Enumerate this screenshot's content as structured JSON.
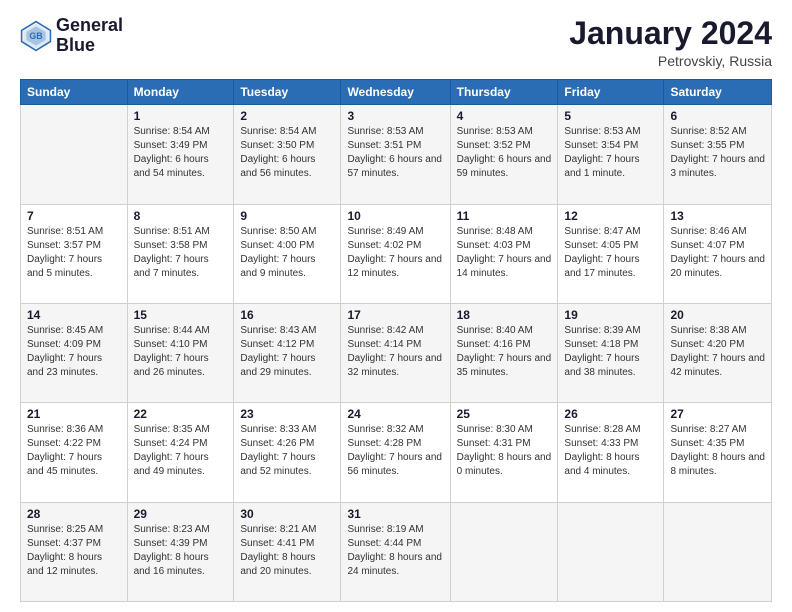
{
  "logo": {
    "line1": "General",
    "line2": "Blue"
  },
  "title": "January 2024",
  "subtitle": "Petrovskiy, Russia",
  "header_days": [
    "Sunday",
    "Monday",
    "Tuesday",
    "Wednesday",
    "Thursday",
    "Friday",
    "Saturday"
  ],
  "weeks": [
    [
      {
        "day": "",
        "sunrise": "",
        "sunset": "",
        "daylight": ""
      },
      {
        "day": "1",
        "sunrise": "Sunrise: 8:54 AM",
        "sunset": "Sunset: 3:49 PM",
        "daylight": "Daylight: 6 hours and 54 minutes."
      },
      {
        "day": "2",
        "sunrise": "Sunrise: 8:54 AM",
        "sunset": "Sunset: 3:50 PM",
        "daylight": "Daylight: 6 hours and 56 minutes."
      },
      {
        "day": "3",
        "sunrise": "Sunrise: 8:53 AM",
        "sunset": "Sunset: 3:51 PM",
        "daylight": "Daylight: 6 hours and 57 minutes."
      },
      {
        "day": "4",
        "sunrise": "Sunrise: 8:53 AM",
        "sunset": "Sunset: 3:52 PM",
        "daylight": "Daylight: 6 hours and 59 minutes."
      },
      {
        "day": "5",
        "sunrise": "Sunrise: 8:53 AM",
        "sunset": "Sunset: 3:54 PM",
        "daylight": "Daylight: 7 hours and 1 minute."
      },
      {
        "day": "6",
        "sunrise": "Sunrise: 8:52 AM",
        "sunset": "Sunset: 3:55 PM",
        "daylight": "Daylight: 7 hours and 3 minutes."
      }
    ],
    [
      {
        "day": "7",
        "sunrise": "Sunrise: 8:51 AM",
        "sunset": "Sunset: 3:57 PM",
        "daylight": "Daylight: 7 hours and 5 minutes."
      },
      {
        "day": "8",
        "sunrise": "Sunrise: 8:51 AM",
        "sunset": "Sunset: 3:58 PM",
        "daylight": "Daylight: 7 hours and 7 minutes."
      },
      {
        "day": "9",
        "sunrise": "Sunrise: 8:50 AM",
        "sunset": "Sunset: 4:00 PM",
        "daylight": "Daylight: 7 hours and 9 minutes."
      },
      {
        "day": "10",
        "sunrise": "Sunrise: 8:49 AM",
        "sunset": "Sunset: 4:02 PM",
        "daylight": "Daylight: 7 hours and 12 minutes."
      },
      {
        "day": "11",
        "sunrise": "Sunrise: 8:48 AM",
        "sunset": "Sunset: 4:03 PM",
        "daylight": "Daylight: 7 hours and 14 minutes."
      },
      {
        "day": "12",
        "sunrise": "Sunrise: 8:47 AM",
        "sunset": "Sunset: 4:05 PM",
        "daylight": "Daylight: 7 hours and 17 minutes."
      },
      {
        "day": "13",
        "sunrise": "Sunrise: 8:46 AM",
        "sunset": "Sunset: 4:07 PM",
        "daylight": "Daylight: 7 hours and 20 minutes."
      }
    ],
    [
      {
        "day": "14",
        "sunrise": "Sunrise: 8:45 AM",
        "sunset": "Sunset: 4:09 PM",
        "daylight": "Daylight: 7 hours and 23 minutes."
      },
      {
        "day": "15",
        "sunrise": "Sunrise: 8:44 AM",
        "sunset": "Sunset: 4:10 PM",
        "daylight": "Daylight: 7 hours and 26 minutes."
      },
      {
        "day": "16",
        "sunrise": "Sunrise: 8:43 AM",
        "sunset": "Sunset: 4:12 PM",
        "daylight": "Daylight: 7 hours and 29 minutes."
      },
      {
        "day": "17",
        "sunrise": "Sunrise: 8:42 AM",
        "sunset": "Sunset: 4:14 PM",
        "daylight": "Daylight: 7 hours and 32 minutes."
      },
      {
        "day": "18",
        "sunrise": "Sunrise: 8:40 AM",
        "sunset": "Sunset: 4:16 PM",
        "daylight": "Daylight: 7 hours and 35 minutes."
      },
      {
        "day": "19",
        "sunrise": "Sunrise: 8:39 AM",
        "sunset": "Sunset: 4:18 PM",
        "daylight": "Daylight: 7 hours and 38 minutes."
      },
      {
        "day": "20",
        "sunrise": "Sunrise: 8:38 AM",
        "sunset": "Sunset: 4:20 PM",
        "daylight": "Daylight: 7 hours and 42 minutes."
      }
    ],
    [
      {
        "day": "21",
        "sunrise": "Sunrise: 8:36 AM",
        "sunset": "Sunset: 4:22 PM",
        "daylight": "Daylight: 7 hours and 45 minutes."
      },
      {
        "day": "22",
        "sunrise": "Sunrise: 8:35 AM",
        "sunset": "Sunset: 4:24 PM",
        "daylight": "Daylight: 7 hours and 49 minutes."
      },
      {
        "day": "23",
        "sunrise": "Sunrise: 8:33 AM",
        "sunset": "Sunset: 4:26 PM",
        "daylight": "Daylight: 7 hours and 52 minutes."
      },
      {
        "day": "24",
        "sunrise": "Sunrise: 8:32 AM",
        "sunset": "Sunset: 4:28 PM",
        "daylight": "Daylight: 7 hours and 56 minutes."
      },
      {
        "day": "25",
        "sunrise": "Sunrise: 8:30 AM",
        "sunset": "Sunset: 4:31 PM",
        "daylight": "Daylight: 8 hours and 0 minutes."
      },
      {
        "day": "26",
        "sunrise": "Sunrise: 8:28 AM",
        "sunset": "Sunset: 4:33 PM",
        "daylight": "Daylight: 8 hours and 4 minutes."
      },
      {
        "day": "27",
        "sunrise": "Sunrise: 8:27 AM",
        "sunset": "Sunset: 4:35 PM",
        "daylight": "Daylight: 8 hours and 8 minutes."
      }
    ],
    [
      {
        "day": "28",
        "sunrise": "Sunrise: 8:25 AM",
        "sunset": "Sunset: 4:37 PM",
        "daylight": "Daylight: 8 hours and 12 minutes."
      },
      {
        "day": "29",
        "sunrise": "Sunrise: 8:23 AM",
        "sunset": "Sunset: 4:39 PM",
        "daylight": "Daylight: 8 hours and 16 minutes."
      },
      {
        "day": "30",
        "sunrise": "Sunrise: 8:21 AM",
        "sunset": "Sunset: 4:41 PM",
        "daylight": "Daylight: 8 hours and 20 minutes."
      },
      {
        "day": "31",
        "sunrise": "Sunrise: 8:19 AM",
        "sunset": "Sunset: 4:44 PM",
        "daylight": "Daylight: 8 hours and 24 minutes."
      },
      {
        "day": "",
        "sunrise": "",
        "sunset": "",
        "daylight": ""
      },
      {
        "day": "",
        "sunrise": "",
        "sunset": "",
        "daylight": ""
      },
      {
        "day": "",
        "sunrise": "",
        "sunset": "",
        "daylight": ""
      }
    ]
  ]
}
